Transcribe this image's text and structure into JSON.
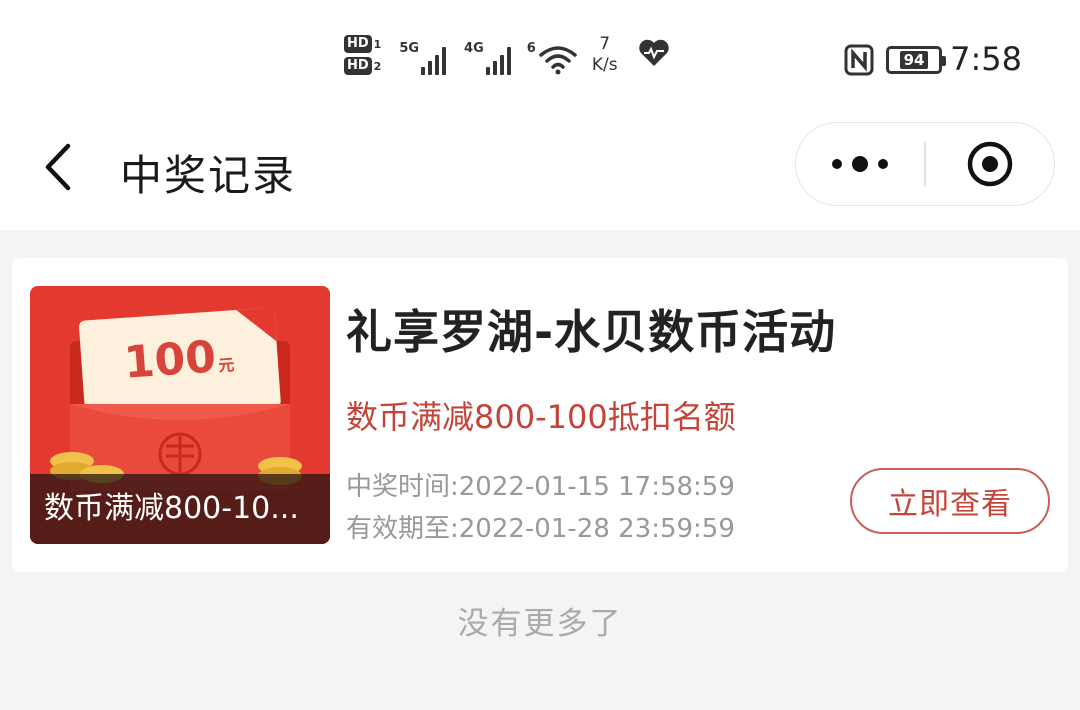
{
  "status_bar": {
    "hd1": "HD",
    "hd1_sub": "1",
    "hd2": "HD",
    "hd2_sub": "2",
    "sim1_network": "5G",
    "sim2_network": "4G",
    "wifi_label": "6",
    "speed_value": "7",
    "speed_unit": "K/s",
    "battery": "94",
    "time": "7:58"
  },
  "nav": {
    "title": "中奖记录"
  },
  "record": {
    "image_amount": "100",
    "image_unit": "元",
    "image_caption": "数币满减800-10...",
    "title": "礼享罗湖-水贝数币活动",
    "subtitle": "数币满减800-100抵扣名额",
    "win_time": "中奖时间:2022-01-15 17:58:59",
    "valid_until": "有效期至:2022-01-28 23:59:59",
    "action_label": "立即查看"
  },
  "footer": {
    "no_more": "没有更多了"
  },
  "colors": {
    "accent": "#c5443a",
    "red_packet": "#e4392e"
  }
}
